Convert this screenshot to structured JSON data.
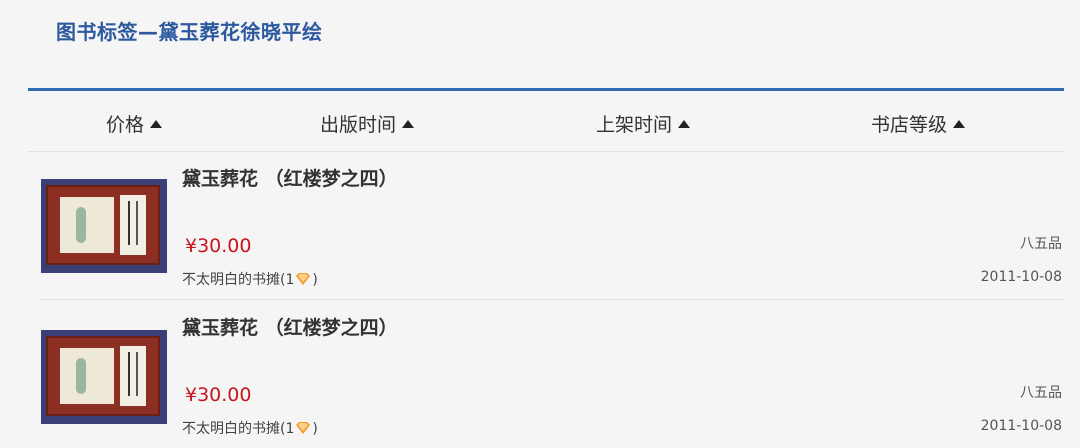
{
  "page": {
    "title": "图书标签—黛玉葬花徐晓平绘"
  },
  "sort_bar": {
    "items": [
      {
        "label": "价格"
      },
      {
        "label": "出版时间"
      },
      {
        "label": "上架时间"
      },
      {
        "label": "书店等级"
      }
    ]
  },
  "listings": [
    {
      "title": "黛玉葬花 （红楼梦之四）",
      "price": "¥30.00",
      "seller": "不太明白的书摊(1",
      "seller_close": ")",
      "condition": "八五品",
      "date": "2011-10-08"
    },
    {
      "title": "黛玉葬花 （红楼梦之四）",
      "price": "¥30.00",
      "seller": "不太明白的书摊(1",
      "seller_close": ")",
      "condition": "八五品",
      "date": "2011-10-08"
    }
  ],
  "colors": {
    "accent": "#2f6bb5",
    "title": "#2d5a9e",
    "price": "#c8161d",
    "gem": "#f39a2b"
  }
}
